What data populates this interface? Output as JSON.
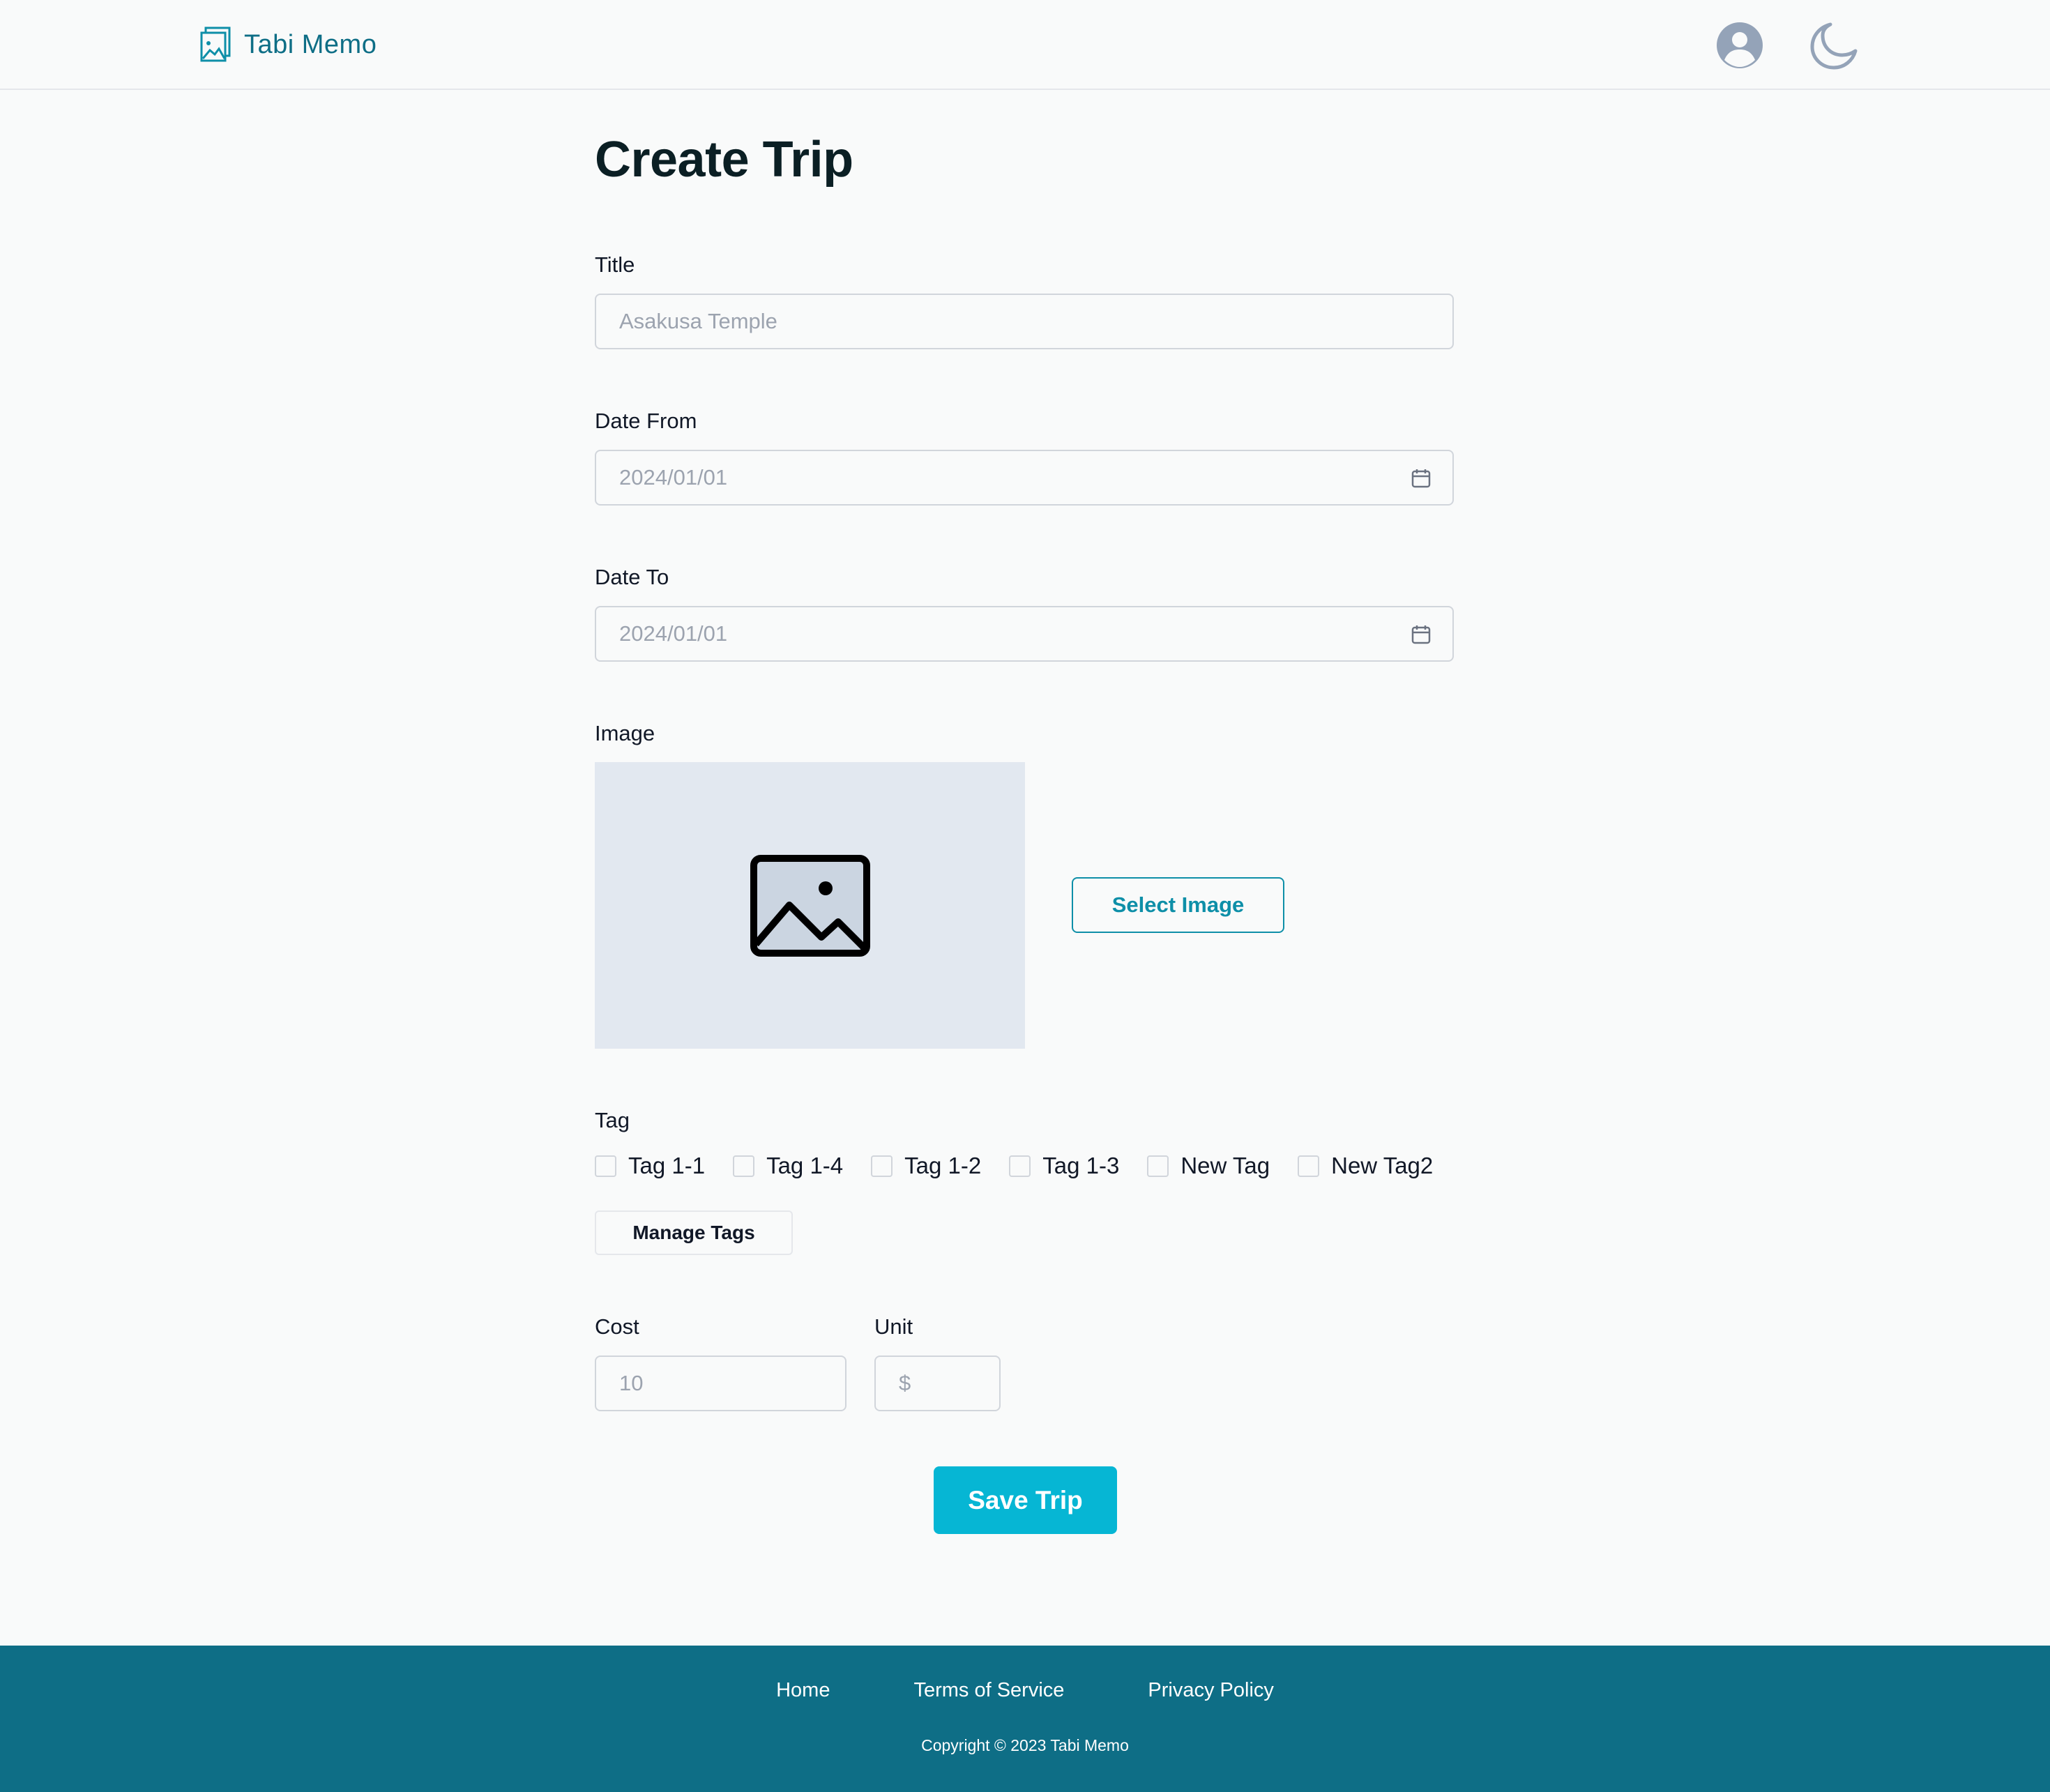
{
  "header": {
    "app_name": "Tabi Memo",
    "icons": [
      "gallery-logo-icon",
      "user-circle-icon",
      "moon-icon"
    ]
  },
  "main": {
    "page_title": "Create Trip",
    "fields": {
      "title": {
        "label": "Title",
        "placeholder": "Asakusa Temple"
      },
      "date_from": {
        "label": "Date From",
        "placeholder": "2024/01/01",
        "icon": "calendar-icon"
      },
      "date_to": {
        "label": "Date To",
        "placeholder": "2024/01/01",
        "icon": "calendar-icon"
      },
      "image": {
        "label": "Image",
        "button_label": "Select Image",
        "placeholder_icon": "image-placeholder-icon"
      },
      "tag": {
        "label": "Tag",
        "options": [
          {
            "label": "Tag 1-1",
            "checked": false
          },
          {
            "label": "Tag 1-4",
            "checked": false
          },
          {
            "label": "Tag 1-2",
            "checked": false
          },
          {
            "label": "Tag 1-3",
            "checked": false
          },
          {
            "label": "New Tag",
            "checked": false
          },
          {
            "label": "New Tag2",
            "checked": false
          }
        ],
        "manage_button_label": "Manage Tags"
      },
      "cost": {
        "label": "Cost",
        "placeholder": "10"
      },
      "unit": {
        "label": "Unit",
        "placeholder": "$"
      }
    },
    "save_button_label": "Save Trip"
  },
  "footer": {
    "links": [
      "Home",
      "Terms of Service",
      "Privacy Policy"
    ],
    "copyright": "Copyright © 2023 Tabi Memo"
  },
  "colors": {
    "brand": "#0e6e86",
    "accent": "#06b6d4",
    "outline_button": "#0e8fa8",
    "background": "#f9fafa",
    "image_placeholder_bg": "#e2e8f0"
  }
}
